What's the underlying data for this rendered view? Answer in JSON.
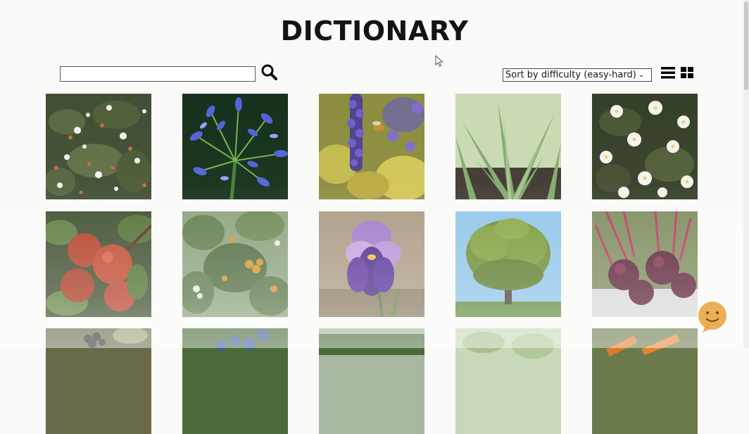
{
  "header": {
    "title": "DICTIONARY"
  },
  "search": {
    "value": "",
    "placeholder": ""
  },
  "sort": {
    "selected": "Sort by difficulty (easy-hard)"
  },
  "view_toggle": {
    "options": [
      "list-icon",
      "grid-icon"
    ]
  },
  "colors": {
    "title": "#111111",
    "background": "#fafaf8",
    "accent": "#e8a23a"
  },
  "gallery": {
    "tiles": [
      {
        "subject": "white-flowering-shrub"
      },
      {
        "subject": "blue-agapanthus"
      },
      {
        "subject": "purple-flower-spike-with-bee"
      },
      {
        "subject": "aloe-vera"
      },
      {
        "subject": "white-anemones"
      },
      {
        "subject": "red-apples"
      },
      {
        "subject": "orange-fruit-tree"
      },
      {
        "subject": "purple-iris"
      },
      {
        "subject": "large-oak-tree"
      },
      {
        "subject": "beetroots"
      },
      {
        "subject": "dark-berries"
      },
      {
        "subject": "blueberries"
      },
      {
        "subject": "tree-line"
      },
      {
        "subject": "pale-green-leaves"
      },
      {
        "subject": "carrots"
      }
    ]
  }
}
